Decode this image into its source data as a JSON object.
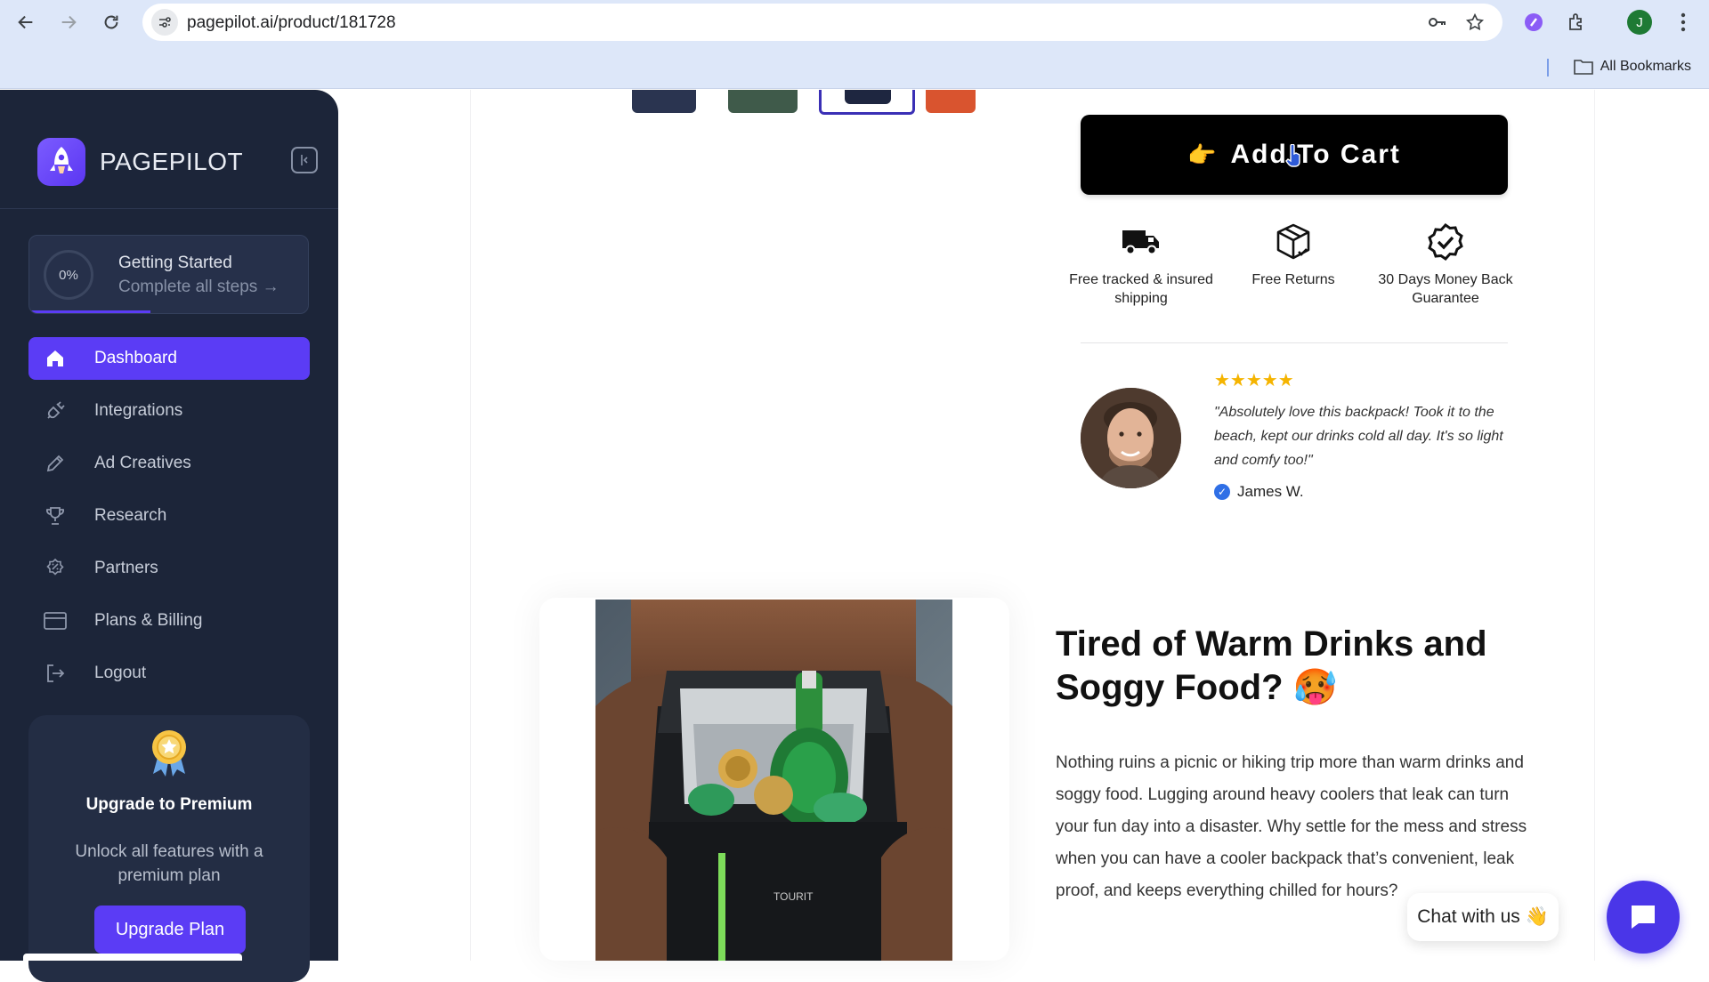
{
  "browser": {
    "url": "pagepilot.ai/product/181728",
    "bookmarks_label": "All Bookmarks",
    "profile_initial": "J"
  },
  "sidebar": {
    "brand": "PAGEPILOT",
    "getting_started": {
      "progress": "0%",
      "title": "Getting Started",
      "subtitle": "Complete all steps →"
    },
    "nav": [
      {
        "label": "Dashboard",
        "icon": "home-icon",
        "active": true
      },
      {
        "label": "Integrations",
        "icon": "plug-icon"
      },
      {
        "label": "Ad Creatives",
        "icon": "pencil-icon"
      },
      {
        "label": "Research",
        "icon": "trophy-icon"
      },
      {
        "label": "Partners",
        "icon": "percent-badge-icon"
      },
      {
        "label": "Plans & Billing",
        "icon": "credit-card-icon"
      },
      {
        "label": "Logout",
        "icon": "logout-icon"
      }
    ],
    "upgrade": {
      "title": "Upgrade to Premium",
      "description": "Unlock all features with a premium plan",
      "button": "Upgrade Plan"
    }
  },
  "product": {
    "add_to_cart": "Add To Cart",
    "features": [
      {
        "icon": "truck-icon",
        "label": "Free tracked & insured shipping"
      },
      {
        "icon": "box-icon",
        "label": "Free Returns"
      },
      {
        "icon": "badge-check-icon",
        "label": "30 Days Money Back Guarantee"
      }
    ],
    "review": {
      "stars": "★★★★★",
      "quote": "\"Absolutely love this backpack! Took it to the beach, kept our drinks cold all day. It's so light and comfy too!\"",
      "author": "James W."
    },
    "section": {
      "headline": "Tired of Warm Drinks and Soggy Food? 🥵",
      "body": "Nothing ruins a picnic or hiking trip more than warm drinks and soggy food. Lugging around heavy coolers that leak can turn your fun day into a disaster. Why settle for the mess and stress when you can have a cooler backpack that’s convenient, leak proof, and keeps everything chilled for hours?"
    }
  },
  "chat": {
    "label": "Chat with us 👋"
  },
  "colors": {
    "accent": "#5b3cf5",
    "sidebar_bg": "#1c2539",
    "chrome_bg": "#dde7f9",
    "star": "#f5b400"
  }
}
